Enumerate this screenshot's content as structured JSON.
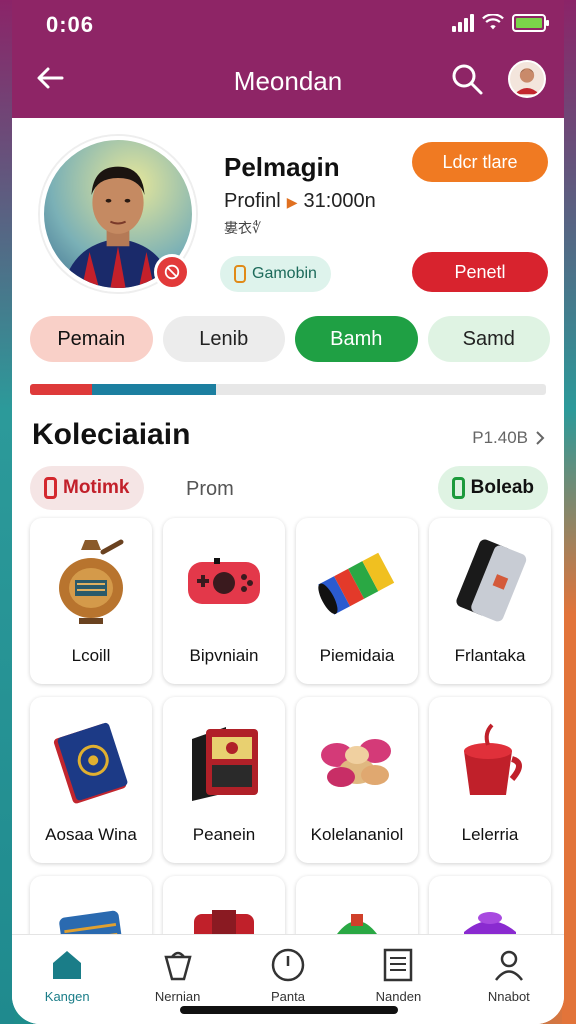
{
  "status": {
    "time": "0:06"
  },
  "header": {
    "title": "Meondan"
  },
  "profile": {
    "name": "Pelmagin",
    "stat_label": "Profinl",
    "stat_value": "31:000n",
    "sub": "婁衣∜",
    "chip": "Gamobin",
    "btn_primary": "Ldcr tlare",
    "btn_secondary": "Penetl"
  },
  "tabs": [
    "Pemain",
    "Lenib",
    "Bamh",
    "Samd"
  ],
  "progress": {
    "red": 0.12,
    "teal": 0.24
  },
  "section": {
    "title": "Koleciaiain",
    "link": "P1.40B"
  },
  "filters": {
    "left": "Motimk",
    "middle": "Prom",
    "right": "Boleab"
  },
  "items": [
    {
      "label": "Lcoill",
      "icon": "bronze-pot-icon"
    },
    {
      "label": "Bipvniain",
      "icon": "game-controller-icon"
    },
    {
      "label": "Piemidaia",
      "icon": "colorful-tube-icon"
    },
    {
      "label": "Frlantaka",
      "icon": "phone-case-icon"
    },
    {
      "label": "Aosaa Wina",
      "icon": "blue-book-icon"
    },
    {
      "label": "Peanein",
      "icon": "red-wallet-icon"
    },
    {
      "label": "Kolelananiol",
      "icon": "pink-snack-icon"
    },
    {
      "label": "Lelerria",
      "icon": "red-cup-icon"
    },
    {
      "label": "",
      "icon": "woven-pouch-icon"
    },
    {
      "label": "",
      "icon": "red-gadget-icon"
    },
    {
      "label": "",
      "icon": "green-toy-icon"
    },
    {
      "label": "",
      "icon": "purple-bag-icon"
    }
  ],
  "nav": [
    "Kangen",
    "Nernian",
    "Panta",
    "Nanden",
    "Nnabot"
  ],
  "colors": {
    "header": "#8e2566",
    "accent_green": "#1fa044",
    "accent_orange": "#f07a22",
    "accent_red": "#d8232e"
  }
}
